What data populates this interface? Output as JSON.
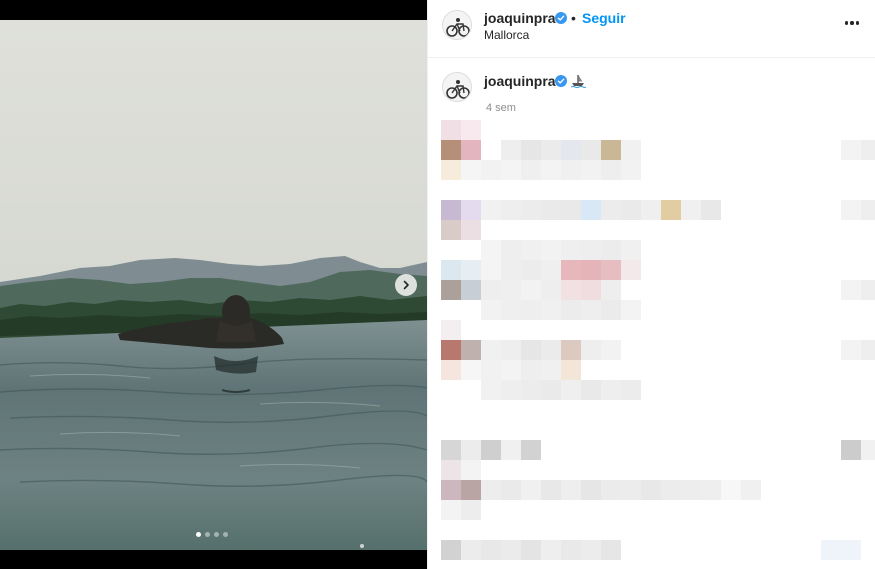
{
  "media": {
    "slide_count": 4,
    "active_slide": 1,
    "next_icon": "chevron-right-icon"
  },
  "post": {
    "username": "joaquinprat",
    "follow_separator": "•",
    "follow_label": "Seguir",
    "location": "Mallorca",
    "more_icon": "more-horizontal-icon",
    "verified_icon": "verified-badge-icon",
    "verified_color": "#3897f0",
    "follow_color": "#0095f6"
  },
  "caption": {
    "username": "joaquinprat",
    "emoji_icon": "boat-icon",
    "age": "4 sem"
  },
  "comments": {
    "pixelated": true
  }
}
